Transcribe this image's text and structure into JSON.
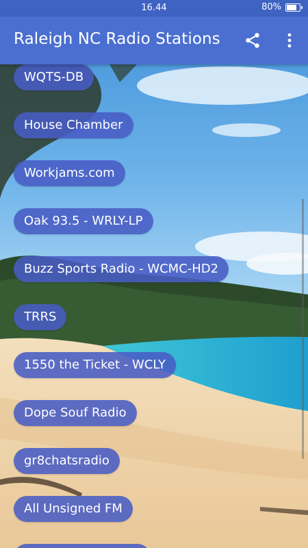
{
  "status_bar": {
    "time": "16.44",
    "battery_percent": "80%",
    "battery_level": 0.8
  },
  "app_bar": {
    "title": "Raleigh NC Radio Stations",
    "share_icon": "share-icon",
    "overflow_icon": "more-vert-icon"
  },
  "stations": [
    {
      "label": "WQTS-DB"
    },
    {
      "label": "House Chamber"
    },
    {
      "label": "Workjams.com"
    },
    {
      "label": "Oak 93.5 - WRLY-LP"
    },
    {
      "label": "Buzz Sports Radio - WCMC-HD2"
    },
    {
      "label": "TRRS"
    },
    {
      "label": "1550 the Ticket - WCLY"
    },
    {
      "label": "Dope Souf Radio"
    },
    {
      "label": "gr8chatsradio"
    },
    {
      "label": "All Unsigned FM"
    },
    {
      "label": ""
    }
  ],
  "colors": {
    "status_bar": "#3F63C3",
    "app_bar": "#4A6FD0",
    "pill": "#485CC4"
  }
}
